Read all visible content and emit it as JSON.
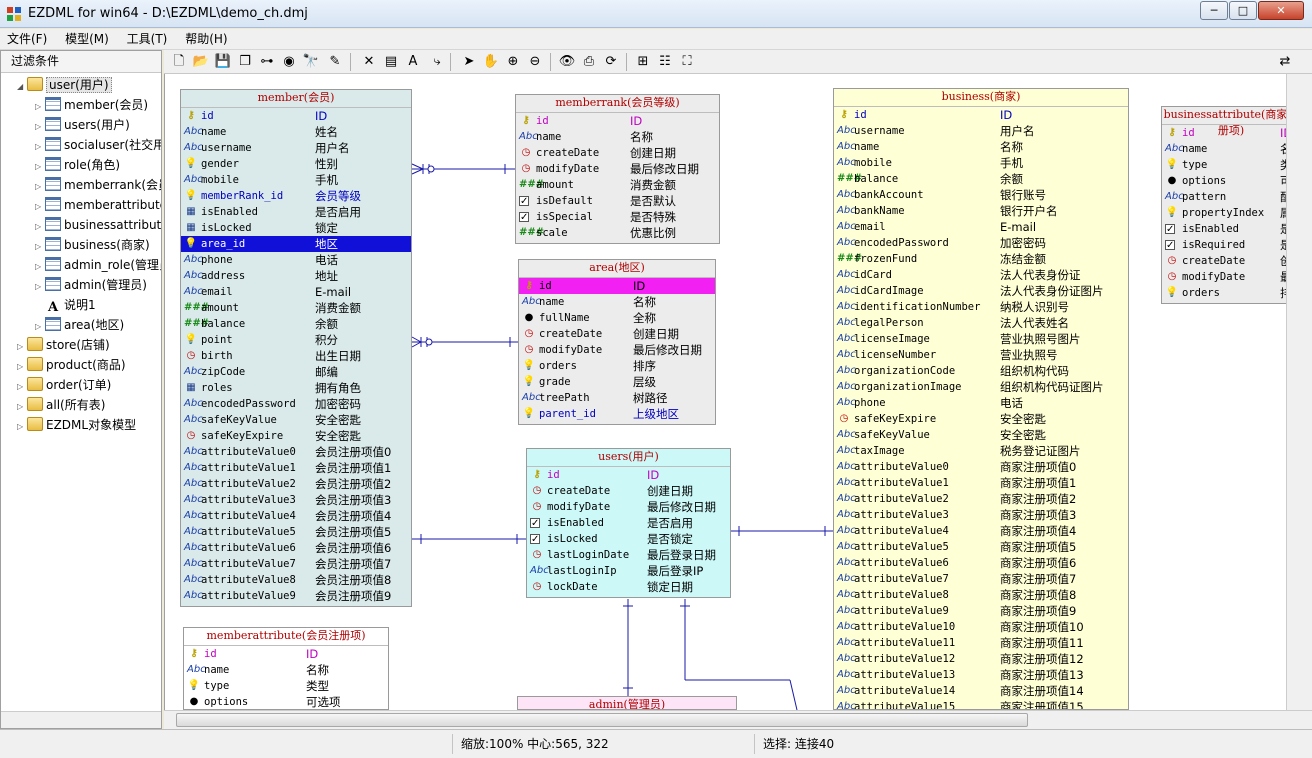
{
  "window": {
    "title": "EZDML for win64 - D:\\EZDML\\demo_ch.dmj",
    "min_glyph": "─",
    "max_glyph": "□",
    "close_glyph": "✕"
  },
  "menu": [
    "文件(F)",
    "模型(M)",
    "工具(T)",
    "帮助(H)"
  ],
  "left_panel": {
    "filter_label": "过滤条件",
    "tree": [
      {
        "label": "user(用户)",
        "icon": "folder",
        "level": 0,
        "expander": "◢",
        "selected": true
      },
      {
        "label": "member(会员)",
        "icon": "table",
        "level": 1,
        "expander": "▷"
      },
      {
        "label": "users(用户)",
        "icon": "table",
        "level": 1,
        "expander": "▷"
      },
      {
        "label": "socialuser(社交用户)",
        "icon": "table",
        "level": 1,
        "expander": "▷"
      },
      {
        "label": "role(角色)",
        "icon": "table",
        "level": 1,
        "expander": "▷"
      },
      {
        "label": "memberrank(会员等级)",
        "icon": "table",
        "level": 1,
        "expander": "▷"
      },
      {
        "label": "memberattribute(会员注册项)",
        "icon": "table",
        "level": 1,
        "expander": "▷"
      },
      {
        "label": "businessattribute(商家注册项)",
        "icon": "table",
        "level": 1,
        "expander": "▷"
      },
      {
        "label": "business(商家)",
        "icon": "table",
        "level": 1,
        "expander": "▷"
      },
      {
        "label": "admin_role(管理员角色)",
        "icon": "table",
        "level": 1,
        "expander": "▷"
      },
      {
        "label": "admin(管理员)",
        "icon": "table",
        "level": 1,
        "expander": "▷"
      },
      {
        "label": "说明1",
        "icon": "text",
        "level": 1,
        "expander": ""
      },
      {
        "label": "area(地区)",
        "icon": "table",
        "level": 1,
        "expander": "▷"
      },
      {
        "label": "store(店铺)",
        "icon": "folder",
        "level": 0,
        "expander": "▷"
      },
      {
        "label": "product(商品)",
        "icon": "folder",
        "level": 0,
        "expander": "▷"
      },
      {
        "label": "order(订单)",
        "icon": "folder",
        "level": 0,
        "expander": "▷"
      },
      {
        "label": "all(所有表)",
        "icon": "folder",
        "level": 0,
        "expander": "▷"
      },
      {
        "label": "EZDML对象模型",
        "icon": "folder",
        "level": 0,
        "expander": "▷"
      }
    ]
  },
  "toolbar": [
    {
      "name": "new-icon",
      "glyph": "🗋"
    },
    {
      "name": "open-icon",
      "glyph": "📂"
    },
    {
      "name": "save-icon",
      "glyph": "💾"
    },
    {
      "name": "copy-icon",
      "glyph": "❐"
    },
    {
      "name": "tree-icon",
      "glyph": "⊶"
    },
    {
      "name": "globe-icon",
      "glyph": "◉"
    },
    {
      "name": "find-icon",
      "glyph": "🔭"
    },
    {
      "name": "highlight-icon",
      "glyph": "✎"
    },
    {
      "name": "delete-icon",
      "glyph": "✕"
    },
    {
      "name": "table-add-icon",
      "glyph": "▤"
    },
    {
      "name": "text-add-icon",
      "glyph": "A"
    },
    {
      "name": "link-icon",
      "glyph": "⤷"
    },
    {
      "name": "pointer-icon",
      "glyph": "➤"
    },
    {
      "name": "hand-icon",
      "glyph": "✋"
    },
    {
      "name": "zoom-in-icon",
      "glyph": "⊕"
    },
    {
      "name": "zoom-out-icon",
      "glyph": "⊖"
    },
    {
      "name": "eye-icon",
      "glyph": "👁"
    },
    {
      "name": "export-icon",
      "glyph": "⎙"
    },
    {
      "name": "refresh-icon",
      "glyph": "⟳"
    },
    {
      "name": "add-field-icon",
      "glyph": "⊞"
    },
    {
      "name": "properties-icon",
      "glyph": "☷"
    },
    {
      "name": "fit-icon",
      "glyph": "⛶"
    },
    {
      "name": "mode-icon",
      "glyph": "⇄"
    }
  ],
  "status": {
    "zoom": "缩放:100% 中心:565, 322",
    "selection": "选择: 连接40"
  },
  "entities": {
    "member": {
      "title": "member(会员)",
      "bg": "#daeaea",
      "fields": [
        {
          "icon": "key",
          "name": "id",
          "disp": "ID",
          "style": "fk"
        },
        {
          "icon": "abc",
          "name": "name",
          "disp": "姓名"
        },
        {
          "icon": "abc",
          "name": "username",
          "disp": "用户名"
        },
        {
          "icon": "bulb",
          "name": "gender",
          "disp": "性别"
        },
        {
          "icon": "abc",
          "name": "mobile",
          "disp": "手机"
        },
        {
          "icon": "bulb",
          "name": "memberRank_id",
          "disp": "会员等级",
          "style": "fk"
        },
        {
          "icon": "list",
          "name": "isEnabled",
          "disp": "是否启用"
        },
        {
          "icon": "list",
          "name": "isLocked",
          "disp": "锁定"
        },
        {
          "icon": "bulb",
          "name": "area_id",
          "disp": "地区",
          "style": "hl-blue"
        },
        {
          "icon": "abc",
          "name": "phone",
          "disp": "电话"
        },
        {
          "icon": "abc",
          "name": "address",
          "disp": "地址"
        },
        {
          "icon": "abc",
          "name": "email",
          "disp": "E-mail"
        },
        {
          "icon": "num",
          "name": "amount",
          "disp": "消费金额"
        },
        {
          "icon": "num",
          "name": "balance",
          "disp": "余额"
        },
        {
          "icon": "bulb",
          "name": "point",
          "disp": "积分"
        },
        {
          "icon": "clock",
          "name": "birth",
          "disp": "出生日期"
        },
        {
          "icon": "abc",
          "name": "zipCode",
          "disp": "邮编"
        },
        {
          "icon": "list",
          "name": "roles",
          "disp": "拥有角色"
        },
        {
          "icon": "abc",
          "name": "encodedPassword",
          "disp": "加密密码"
        },
        {
          "icon": "abc",
          "name": "safeKeyValue",
          "disp": "安全密匙"
        },
        {
          "icon": "clock",
          "name": "safeKeyExpire",
          "disp": "安全密匙"
        },
        {
          "icon": "abc",
          "name": "attributeValue0",
          "disp": "会员注册项值0"
        },
        {
          "icon": "abc",
          "name": "attributeValue1",
          "disp": "会员注册项值1"
        },
        {
          "icon": "abc",
          "name": "attributeValue2",
          "disp": "会员注册项值2"
        },
        {
          "icon": "abc",
          "name": "attributeValue3",
          "disp": "会员注册项值3"
        },
        {
          "icon": "abc",
          "name": "attributeValue4",
          "disp": "会员注册项值4"
        },
        {
          "icon": "abc",
          "name": "attributeValue5",
          "disp": "会员注册项值5"
        },
        {
          "icon": "abc",
          "name": "attributeValue6",
          "disp": "会员注册项值6"
        },
        {
          "icon": "abc",
          "name": "attributeValue7",
          "disp": "会员注册项值7"
        },
        {
          "icon": "abc",
          "name": "attributeValue8",
          "disp": "会员注册项值8"
        },
        {
          "icon": "abc",
          "name": "attributeValue9",
          "disp": "会员注册项值9"
        }
      ]
    },
    "memberrank": {
      "title": "memberrank(会员等级)",
      "bg": "#ececec",
      "fields": [
        {
          "icon": "key",
          "name": "id",
          "disp": "ID",
          "style": "pk"
        },
        {
          "icon": "abc",
          "name": "name",
          "disp": "名称"
        },
        {
          "icon": "clock",
          "name": "createDate",
          "disp": "创建日期"
        },
        {
          "icon": "clock",
          "name": "modifyDate",
          "disp": "最后修改日期"
        },
        {
          "icon": "num",
          "name": "amount",
          "disp": "消费金额"
        },
        {
          "icon": "check",
          "name": "isDefault",
          "disp": "是否默认"
        },
        {
          "icon": "check",
          "name": "isSpecial",
          "disp": "是否特殊"
        },
        {
          "icon": "num",
          "name": "scale",
          "disp": "优惠比例"
        }
      ]
    },
    "area": {
      "title": "area(地区)",
      "bg": "#ececec",
      "fields": [
        {
          "icon": "key",
          "name": "id",
          "disp": "ID",
          "style": "hl-magenta"
        },
        {
          "icon": "abc",
          "name": "name",
          "disp": "名称"
        },
        {
          "icon": "dot",
          "name": "fullName",
          "disp": "全称"
        },
        {
          "icon": "clock",
          "name": "createDate",
          "disp": "创建日期"
        },
        {
          "icon": "clock",
          "name": "modifyDate",
          "disp": "最后修改日期"
        },
        {
          "icon": "bulb",
          "name": "orders",
          "disp": "排序"
        },
        {
          "icon": "bulb",
          "name": "grade",
          "disp": "层级"
        },
        {
          "icon": "abc",
          "name": "treePath",
          "disp": "树路径"
        },
        {
          "icon": "bulb",
          "name": "parent_id",
          "disp": "上级地区",
          "style": "fk"
        }
      ]
    },
    "users": {
      "title": "users(用户)",
      "bg": "#cdf8f8",
      "fields": [
        {
          "icon": "key",
          "name": "id",
          "disp": "ID",
          "style": "pk"
        },
        {
          "icon": "clock",
          "name": "createDate",
          "disp": "创建日期"
        },
        {
          "icon": "clock",
          "name": "modifyDate",
          "disp": "最后修改日期"
        },
        {
          "icon": "check",
          "name": "isEnabled",
          "disp": "是否启用"
        },
        {
          "icon": "check",
          "name": "isLocked",
          "disp": "是否锁定"
        },
        {
          "icon": "clock",
          "name": "lastLoginDate",
          "disp": "最后登录日期"
        },
        {
          "icon": "abc",
          "name": "lastLoginIp",
          "disp": "最后登录IP"
        },
        {
          "icon": "clock",
          "name": "lockDate",
          "disp": "锁定日期"
        }
      ]
    },
    "memberattribute": {
      "title": "memberattribute(会员注册项)",
      "bg": "#ffffff",
      "fields": [
        {
          "icon": "key",
          "name": "id",
          "disp": "ID",
          "style": "pk"
        },
        {
          "icon": "abc",
          "name": "name",
          "disp": "名称"
        },
        {
          "icon": "bulb",
          "name": "type",
          "disp": "类型"
        },
        {
          "icon": "dot",
          "name": "options",
          "disp": "可选项"
        }
      ]
    },
    "admin": {
      "title": "admin(管理员)",
      "bg": "#fde4f7",
      "fields": []
    },
    "business": {
      "title": "business(商家)",
      "bg": "#ffffd6",
      "fields": [
        {
          "icon": "key",
          "name": "id",
          "disp": "ID",
          "style": "fk"
        },
        {
          "icon": "abc",
          "name": "username",
          "disp": "用户名"
        },
        {
          "icon": "abc",
          "name": "name",
          "disp": "名称"
        },
        {
          "icon": "abc",
          "name": "mobile",
          "disp": "手机"
        },
        {
          "icon": "num",
          "name": "balance",
          "disp": "余额"
        },
        {
          "icon": "abc",
          "name": "bankAccount",
          "disp": "银行账号"
        },
        {
          "icon": "abc",
          "name": "bankName",
          "disp": "银行开户名"
        },
        {
          "icon": "abc",
          "name": "email",
          "disp": "E-mail"
        },
        {
          "icon": "abc",
          "name": "encodedPassword",
          "disp": "加密密码"
        },
        {
          "icon": "num",
          "name": "frozenFund",
          "disp": "冻结金额"
        },
        {
          "icon": "abc",
          "name": "idCard",
          "disp": "法人代表身份证"
        },
        {
          "icon": "abc",
          "name": "idCardImage",
          "disp": "法人代表身份证图片"
        },
        {
          "icon": "abc",
          "name": "identificationNumber",
          "disp": "纳税人识别号"
        },
        {
          "icon": "abc",
          "name": "legalPerson",
          "disp": "法人代表姓名"
        },
        {
          "icon": "abc",
          "name": "licenseImage",
          "disp": "营业执照号图片"
        },
        {
          "icon": "abc",
          "name": "licenseNumber",
          "disp": "营业执照号"
        },
        {
          "icon": "abc",
          "name": "organizationCode",
          "disp": "组织机构代码"
        },
        {
          "icon": "abc",
          "name": "organizationImage",
          "disp": "组织机构代码证图片"
        },
        {
          "icon": "abc",
          "name": "phone",
          "disp": "电话"
        },
        {
          "icon": "clock",
          "name": "safeKeyExpire",
          "disp": "安全密匙"
        },
        {
          "icon": "abc",
          "name": "safeKeyValue",
          "disp": "安全密匙"
        },
        {
          "icon": "abc",
          "name": "taxImage",
          "disp": "税务登记证图片"
        },
        {
          "icon": "abc",
          "name": "attributeValue0",
          "disp": "商家注册项值0"
        },
        {
          "icon": "abc",
          "name": "attributeValue1",
          "disp": "商家注册项值1"
        },
        {
          "icon": "abc",
          "name": "attributeValue2",
          "disp": "商家注册项值2"
        },
        {
          "icon": "abc",
          "name": "attributeValue3",
          "disp": "商家注册项值3"
        },
        {
          "icon": "abc",
          "name": "attributeValue4",
          "disp": "商家注册项值4"
        },
        {
          "icon": "abc",
          "name": "attributeValue5",
          "disp": "商家注册项值5"
        },
        {
          "icon": "abc",
          "name": "attributeValue6",
          "disp": "商家注册项值6"
        },
        {
          "icon": "abc",
          "name": "attributeValue7",
          "disp": "商家注册项值7"
        },
        {
          "icon": "abc",
          "name": "attributeValue8",
          "disp": "商家注册项值8"
        },
        {
          "icon": "abc",
          "name": "attributeValue9",
          "disp": "商家注册项值9"
        },
        {
          "icon": "abc",
          "name": "attributeValue10",
          "disp": "商家注册项值10"
        },
        {
          "icon": "abc",
          "name": "attributeValue11",
          "disp": "商家注册项值11"
        },
        {
          "icon": "abc",
          "name": "attributeValue12",
          "disp": "商家注册项值12"
        },
        {
          "icon": "abc",
          "name": "attributeValue13",
          "disp": "商家注册项值13"
        },
        {
          "icon": "abc",
          "name": "attributeValue14",
          "disp": "商家注册项值14"
        },
        {
          "icon": "abc",
          "name": "attributeValue15",
          "disp": "商家注册项值15"
        }
      ]
    },
    "businessattribute": {
      "title": "businessattribute(商家注册项)",
      "bg": "#ececec",
      "fields": [
        {
          "icon": "key",
          "name": "id",
          "disp": "ID",
          "style": "pk"
        },
        {
          "icon": "abc",
          "name": "name",
          "disp": "名称"
        },
        {
          "icon": "bulb",
          "name": "type",
          "disp": "类型"
        },
        {
          "icon": "dot",
          "name": "options",
          "disp": "可选项"
        },
        {
          "icon": "abc",
          "name": "pattern",
          "disp": "配置"
        },
        {
          "icon": "bulb",
          "name": "propertyIndex",
          "disp": "属性序号"
        },
        {
          "icon": "check",
          "name": "isEnabled",
          "disp": "是否启用"
        },
        {
          "icon": "check",
          "name": "isRequired",
          "disp": "是否必填"
        },
        {
          "icon": "clock",
          "name": "createDate",
          "disp": "创建日期"
        },
        {
          "icon": "clock",
          "name": "modifyDate",
          "disp": "最后修改日期"
        },
        {
          "icon": "bulb",
          "name": "orders",
          "disp": "排序"
        }
      ]
    }
  },
  "colors": {
    "pk": "#c000c0",
    "fk": "#0000c0",
    "title": "#b00000",
    "link": "#1a1aa8"
  }
}
